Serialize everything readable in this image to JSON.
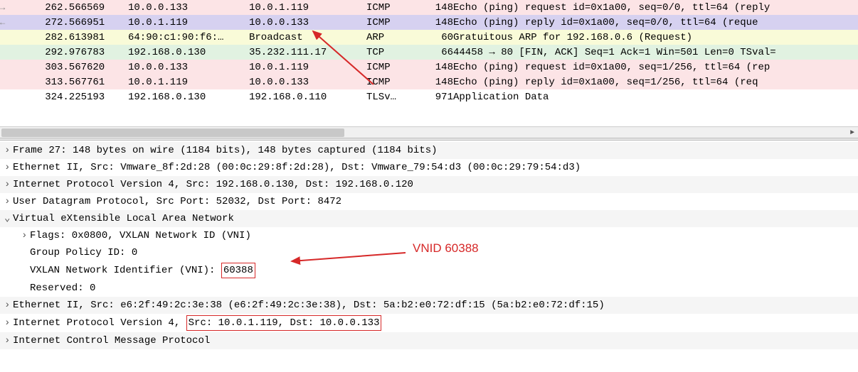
{
  "packets": [
    {
      "no": "26",
      "time": "2.566569",
      "src": "10.0.0.133",
      "dst": "10.0.1.119",
      "proto": "ICMP",
      "len": "148",
      "info": "Echo (ping) request  id=0x1a00, seq=0/0, ttl=64 (reply",
      "cls": "row-pink",
      "mark": "→"
    },
    {
      "no": "27",
      "time": "2.566951",
      "src": "10.0.1.119",
      "dst": "10.0.0.133",
      "proto": "ICMP",
      "len": "148",
      "info": "Echo (ping) reply    id=0x1a00, seq=0/0, ttl=64 (reque",
      "cls": "row-purple",
      "mark": "←"
    },
    {
      "no": "28",
      "time": "2.613981",
      "src": "64:90:c1:90:f6:…",
      "dst": "Broadcast",
      "proto": "ARP",
      "len": "60",
      "info": "Gratuitous ARP for 192.168.0.6 (Request)",
      "cls": "row-yellow",
      "mark": ""
    },
    {
      "no": "29",
      "time": "2.976783",
      "src": "192.168.0.130",
      "dst": "35.232.111.17",
      "proto": "TCP",
      "len": "66",
      "info": "44458 → 80 [FIN, ACK] Seq=1 Ack=1 Win=501 Len=0 TSval=",
      "cls": "row-green",
      "mark": ""
    },
    {
      "no": "30",
      "time": "3.567620",
      "src": "10.0.0.133",
      "dst": "10.0.1.119",
      "proto": "ICMP",
      "len": "148",
      "info": "Echo (ping) request  id=0x1a00, seq=1/256, ttl=64 (rep",
      "cls": "row-pink",
      "mark": ""
    },
    {
      "no": "31",
      "time": "3.567761",
      "src": "10.0.1.119",
      "dst": "10.0.0.133",
      "proto": "ICMP",
      "len": "148",
      "info": "Echo (ping) reply    id=0x1a00, seq=1/256, ttl=64 (req",
      "cls": "row-pink",
      "mark": ""
    },
    {
      "no": "32",
      "time": "4.225193",
      "src": "192.168.0.130",
      "dst": "192.168.0.110",
      "proto": "TLSv…",
      "len": "971",
      "info": "Application Data",
      "cls": "row-white",
      "mark": ""
    }
  ],
  "details": {
    "frame": "Frame 27: 148 bytes on wire (1184 bits), 148 bytes captured (1184 bits)",
    "eth_outer": "Ethernet II, Src: Vmware_8f:2d:28 (00:0c:29:8f:2d:28), Dst: Vmware_79:54:d3 (00:0c:29:79:54:d3)",
    "ip_outer": "Internet Protocol Version 4, Src: 192.168.0.130, Dst: 192.168.0.120",
    "udp": "User Datagram Protocol, Src Port: 52032, Dst Port: 8472",
    "vxlan": "Virtual eXtensible Local Area Network",
    "vxlan_flags": "Flags: 0x0800, VXLAN Network ID (VNI)",
    "vxlan_gpid": "Group Policy ID: 0",
    "vxlan_vni_pre": "VXLAN Network Identifier (VNI): ",
    "vxlan_vni_val": "60388",
    "vxlan_res": "Reserved: 0",
    "eth_inner": "Ethernet II, Src: e6:2f:49:2c:3e:38 (e6:2f:49:2c:3e:38), Dst: 5a:b2:e0:72:df:15 (5a:b2:e0:72:df:15)",
    "ip_inner_pre": "Internet Protocol Version 4, ",
    "ip_inner_box": "Src: 10.0.1.119, Dst: 10.0.0.133",
    "icmp": "Internet Control Message Protocol"
  },
  "annotation": {
    "vnid_label": "VNID 60388"
  }
}
